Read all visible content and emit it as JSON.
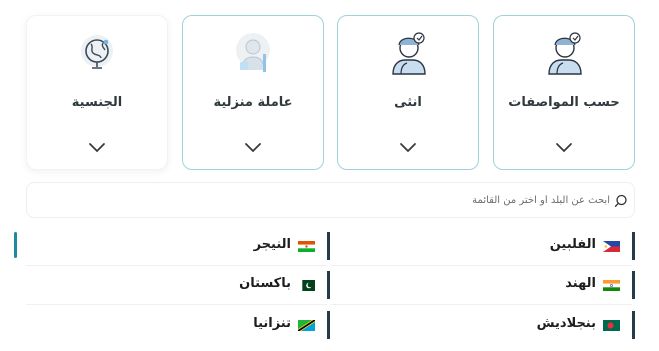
{
  "filters": [
    {
      "label": "حسب المواصفات",
      "icon": "profile-specs-icon"
    },
    {
      "label": "انثى",
      "icon": "female-profile-icon"
    },
    {
      "label": "عاملة منزلية",
      "icon": "housemaid-icon"
    },
    {
      "label": "الجنسية",
      "icon": "globe-icon"
    }
  ],
  "search": {
    "placeholder": "ابحث عن البلد أو اختر من القائمة",
    "icon": "search-icon"
  },
  "countries": {
    "right": [
      {
        "name": "الفلبين",
        "flag": "philippines-flag-icon"
      },
      {
        "name": "الهند",
        "flag": "india-flag-icon"
      },
      {
        "name": "بنجلاديش",
        "flag": "bangladesh-flag-icon"
      }
    ],
    "left": [
      {
        "name": "النيجر",
        "flag": "niger-flag-icon"
      },
      {
        "name": "باكستان",
        "flag": "pakistan-flag-icon"
      },
      {
        "name": "تنزانيا",
        "flag": "tanzania-flag-icon"
      }
    ]
  },
  "colors": {
    "accent": "#1f8a9c",
    "card_border": "#9fd3dc",
    "item_bar": "#263b4a"
  }
}
